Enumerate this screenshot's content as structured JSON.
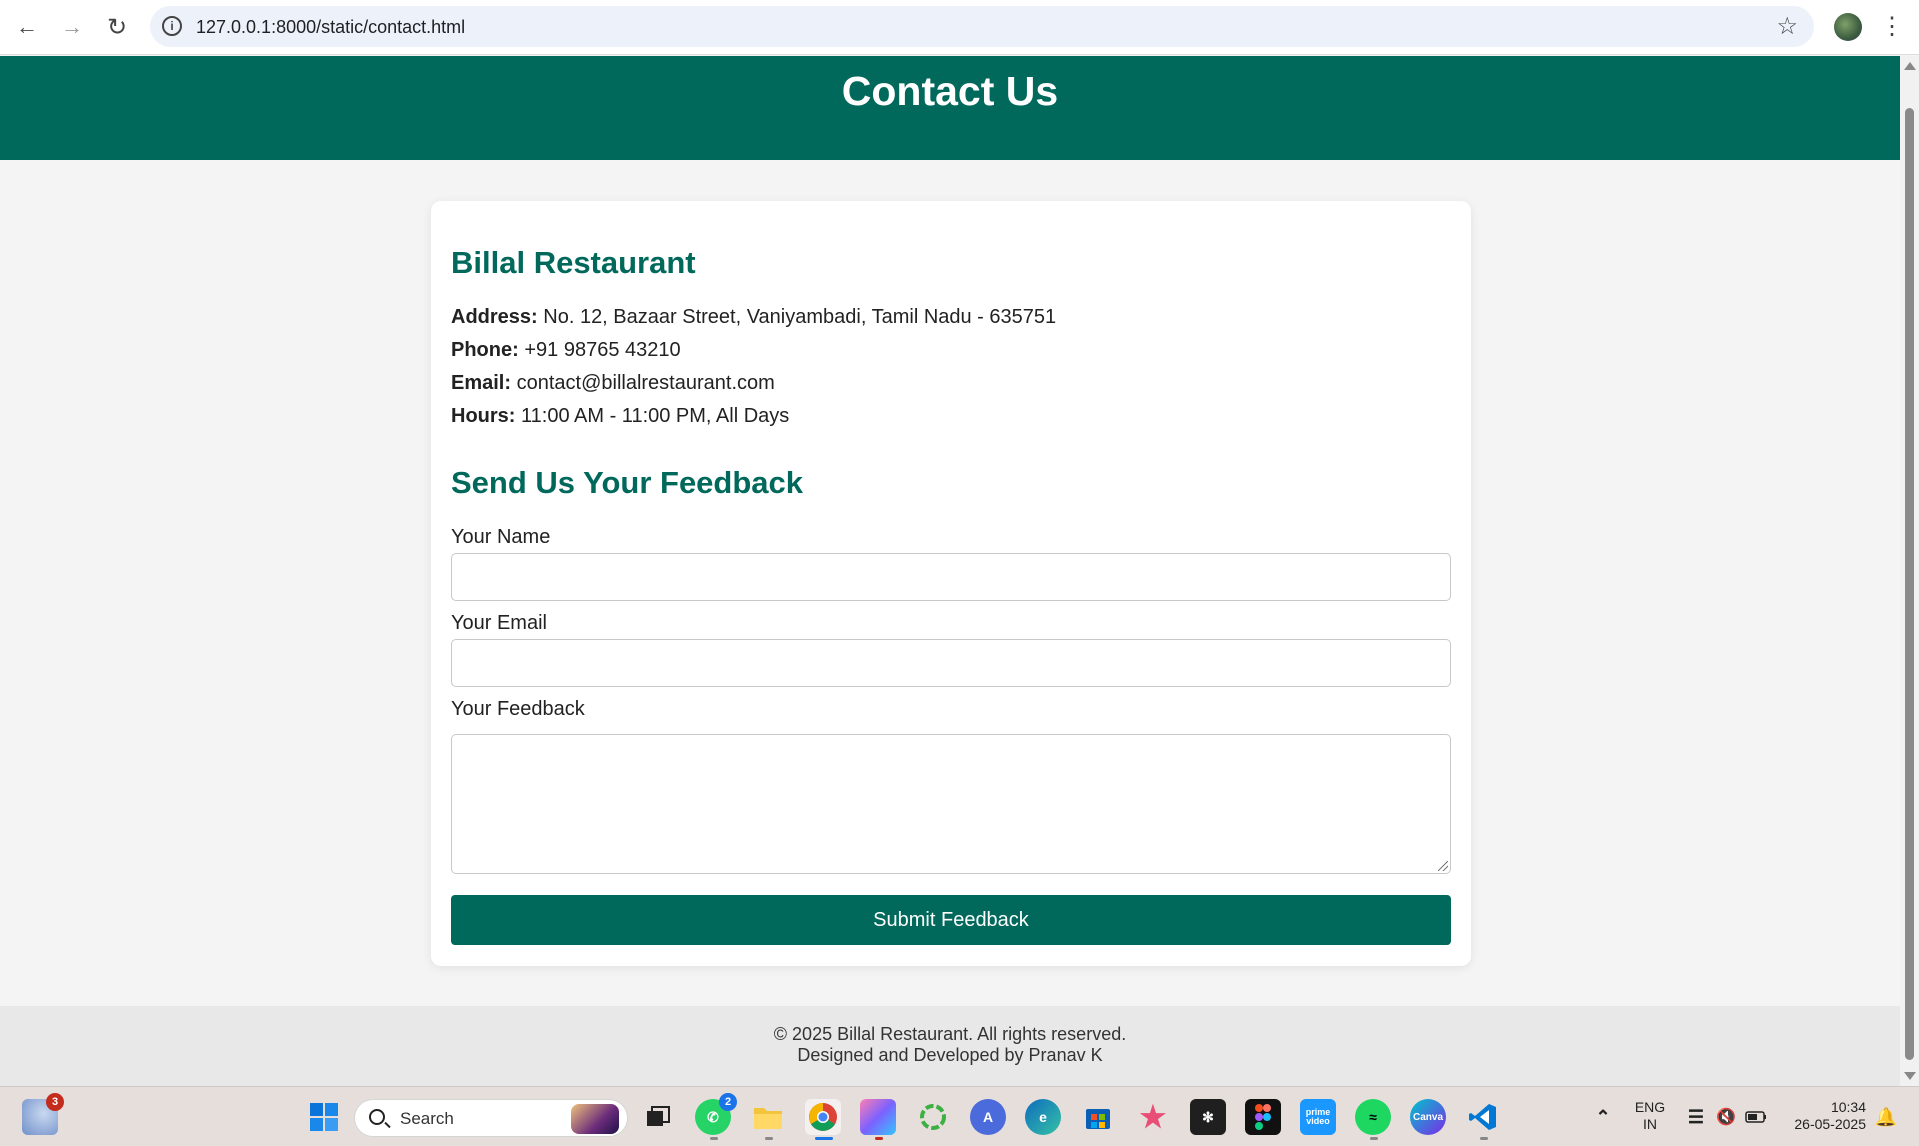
{
  "browser": {
    "url": "127.0.0.1:8000/static/contact.html"
  },
  "page": {
    "header_title": "Contact Us",
    "restaurant": {
      "name": "Billal Restaurant",
      "address_label": "Address:",
      "address": " No. 12, Bazaar Street, Vaniyambadi, Tamil Nadu - 635751",
      "phone_label": "Phone:",
      "phone": " +91 98765 43210",
      "email_label": "Email:",
      "email": " contact@billalrestaurant.com",
      "hours_label": "Hours:",
      "hours": " 11:00 AM - 11:00 PM, All Days"
    },
    "feedback": {
      "title": "Send Us Your Feedback",
      "name_label": "Your Name",
      "name_value": "",
      "email_label": "Your Email",
      "email_value": "",
      "feedback_label": "Your Feedback",
      "feedback_value": "",
      "submit_label": "Submit Feedback"
    },
    "footer": {
      "copyright": "© 2025 Billal Restaurant. All rights reserved.",
      "credit": "Designed and Developed by Pranav K"
    }
  },
  "taskbar": {
    "weather_badge": "3",
    "search_label": "Search",
    "whatsapp_badge": "2",
    "language": "ENG",
    "region": "IN",
    "time": "10:34",
    "date": "26-05-2025"
  },
  "colors": {
    "brand": "#00695c",
    "page_bg": "#f4f4f4"
  }
}
